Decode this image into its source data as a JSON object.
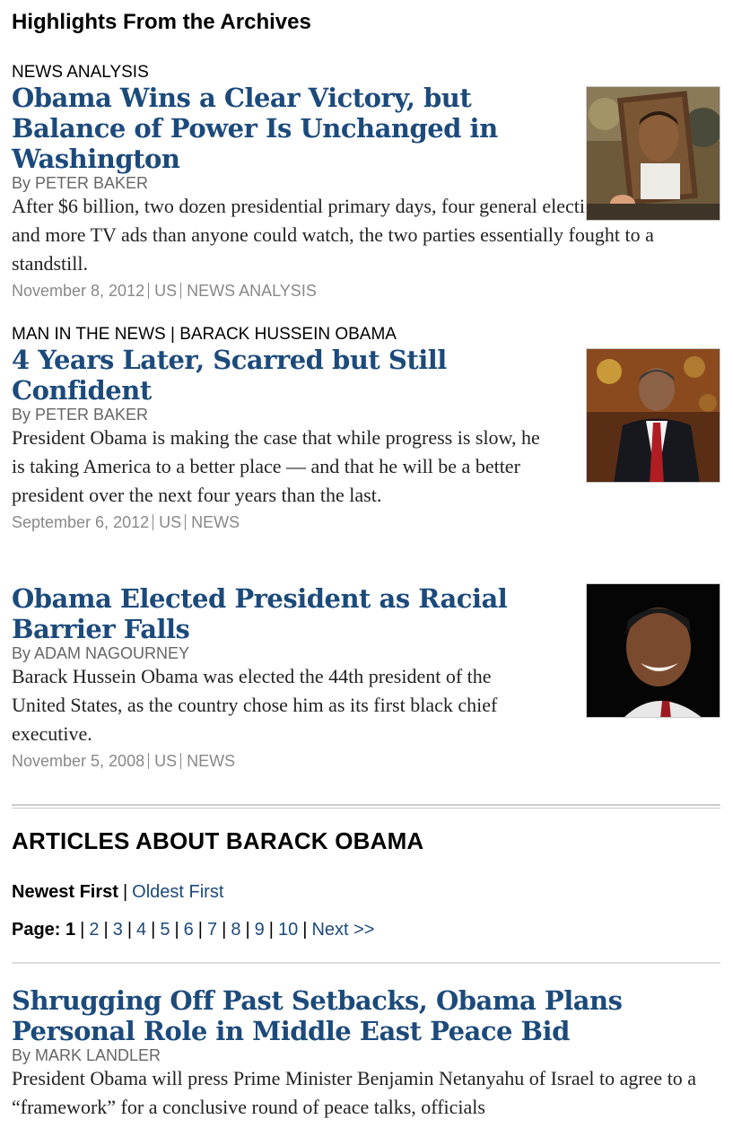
{
  "highlights": {
    "title": "Highlights From the Archives",
    "articles": [
      {
        "kicker": "NEWS ANALYSIS",
        "headline": "Obama Wins a Clear Victory, but Balance of Power Is Unchanged in Washington",
        "byline": "By PETER BAKER",
        "summary": "After $6 billion, two dozen presidential primary days, four general election debates and more TV ads than anyone could watch, the two parties essentially fought to a standstill.",
        "date": "November 8, 2012",
        "section": "US",
        "type": "NEWS ANALYSIS"
      },
      {
        "kicker": "MAN IN THE NEWS | BARACK HUSSEIN OBAMA",
        "headline": "4 Years Later, Scarred but Still Confident",
        "byline": "By PETER BAKER",
        "summary": "President Obama is making the case that while progress is slow, he is taking America to a better place — and that he will be a better president over the next four years than the last.",
        "date": "September 6, 2012",
        "section": "US",
        "type": "NEWS"
      },
      {
        "headline": "Obama Elected President as Racial Barrier Falls",
        "byline": "By ADAM NAGOURNEY",
        "summary": "Barack Hussein Obama was elected the 44th president of the United States, as the country chose him as its first black chief executive.",
        "date": "November 5, 2008",
        "section": "US",
        "type": "NEWS"
      }
    ]
  },
  "articles_about": {
    "title": "ARTICLES ABOUT BARACK OBAMA",
    "sort": {
      "newest": "Newest First",
      "oldest": "Oldest First"
    },
    "pager": {
      "label": "Page:",
      "current": "1",
      "pages": [
        "2",
        "3",
        "4",
        "5",
        "6",
        "7",
        "8",
        "9",
        "10"
      ],
      "next": "Next >>"
    },
    "list": [
      {
        "headline": "Shrugging Off Past Setbacks, Obama Plans Personal Role in Middle East Peace Bid",
        "byline": "By MARK LANDLER",
        "summary": "President Obama will press Prime Minister Benjamin Netanyahu of Israel to agree to a “framework” for a conclusive round of peace talks, officials"
      }
    ]
  }
}
